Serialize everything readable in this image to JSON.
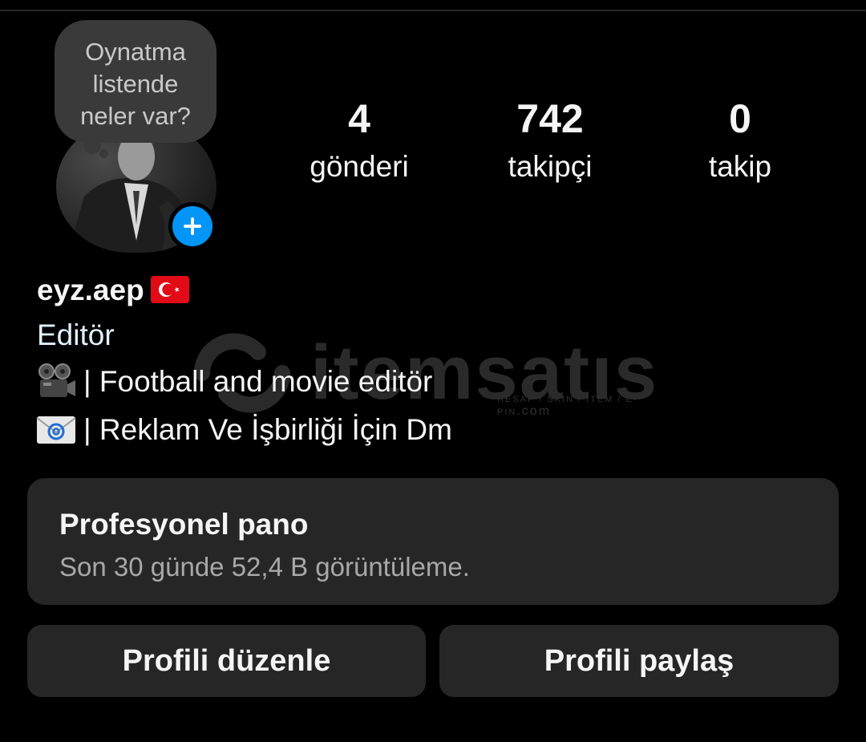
{
  "note": {
    "text_line1": "Oynatma",
    "text_line2": "listende",
    "text_line3": "neler var?"
  },
  "stats": {
    "posts": {
      "value": "4",
      "label": "gönderi"
    },
    "followers": {
      "value": "742",
      "label": "takipçi"
    },
    "following": {
      "value": "0",
      "label": "takip"
    }
  },
  "profile": {
    "username": "eyz.aep",
    "flag_icon": "turkey-flag-icon",
    "category": "Editör",
    "bio": [
      {
        "icon": "film-camera-icon",
        "text": "| Football and movie editör"
      },
      {
        "icon": "envelope-at-icon",
        "text": "| Reklam Ve İşbirliği İçin Dm"
      }
    ]
  },
  "watermark": {
    "brand": "itemsatıs",
    "tagline": "HESAP / SKIN / ITEM / E-PIN",
    "suffix": ".com"
  },
  "dashboard": {
    "title": "Profesyonel pano",
    "subtitle": "Son 30 günde 52,4 B görüntüleme."
  },
  "buttons": {
    "edit_profile": "Profili düzenle",
    "share_profile": "Profili paylaş"
  },
  "colors": {
    "background": "#000000",
    "card": "#262626",
    "accent_blue": "#0095f6",
    "category_text": "#e0f1ff",
    "muted_text": "#a8a8a8"
  }
}
